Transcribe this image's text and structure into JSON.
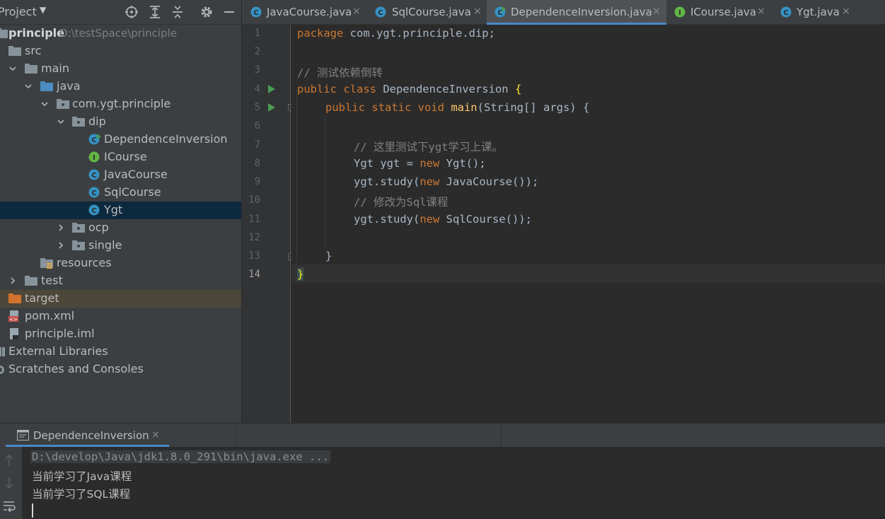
{
  "project_panel": {
    "title": "Project",
    "tree": [
      {
        "label": "principle",
        "path": "D:\\testSpace\\principle"
      },
      {
        "label": "src"
      },
      {
        "label": "main"
      },
      {
        "label": "java"
      },
      {
        "label": "com.ygt.principle"
      },
      {
        "label": "dip"
      },
      {
        "label": "DependenceInversion"
      },
      {
        "label": "ICourse"
      },
      {
        "label": "JavaCourse"
      },
      {
        "label": "SqlCourse"
      },
      {
        "label": "Ygt"
      },
      {
        "label": "ocp"
      },
      {
        "label": "single"
      },
      {
        "label": "resources"
      },
      {
        "label": "test"
      },
      {
        "label": "target"
      },
      {
        "label": "pom.xml"
      },
      {
        "label": "principle.iml"
      },
      {
        "label": "External Libraries"
      },
      {
        "label": "Scratches and Consoles"
      }
    ]
  },
  "tabs": [
    {
      "label": "JavaCourse.java",
      "close": "×"
    },
    {
      "label": "SqlCourse.java",
      "close": "×"
    },
    {
      "label": "DependenceInversion.java",
      "close": "×"
    },
    {
      "label": "ICourse.java",
      "close": "×"
    },
    {
      "label": "Ygt.java",
      "close": "×"
    }
  ],
  "editor": {
    "line_numbers": [
      "1",
      "2",
      "3",
      "4",
      "5",
      "6",
      "7",
      "8",
      "9",
      "10",
      "11",
      "12",
      "13",
      "14"
    ],
    "lines": {
      "l1_kw": "package",
      "l1_rest": " com.ygt.principle.dip;",
      "l3": "// 测试依赖倒转",
      "l4_kw": "public class",
      "l4_name": " DependenceInversion ",
      "l4_brace": "{",
      "l5_kw": "public static void",
      "l5_fn": " main",
      "l5_rest": "(String[] args) {",
      "l7": "// 这里测试下ygt学习上课。",
      "l8_a": "Ygt ygt = ",
      "l8_kw": "new",
      "l8_b": " Ygt();",
      "l9_a": "ygt.study(",
      "l9_kw": "new",
      "l9_b": " JavaCourse());",
      "l10": "// 修改为Sql课程",
      "l11_a": "ygt.study(",
      "l11_kw": "new",
      "l11_b": " SqlCourse());",
      "l13": "}",
      "l14": "}"
    }
  },
  "run_panel": {
    "tab_label": "DependenceInversion",
    "tab_close": "×",
    "console": [
      "D:\\develop\\Java\\jdk1.8.0_291\\bin\\java.exe ...",
      "当前学习了Java课程",
      "当前学习了SQL课程"
    ]
  }
}
